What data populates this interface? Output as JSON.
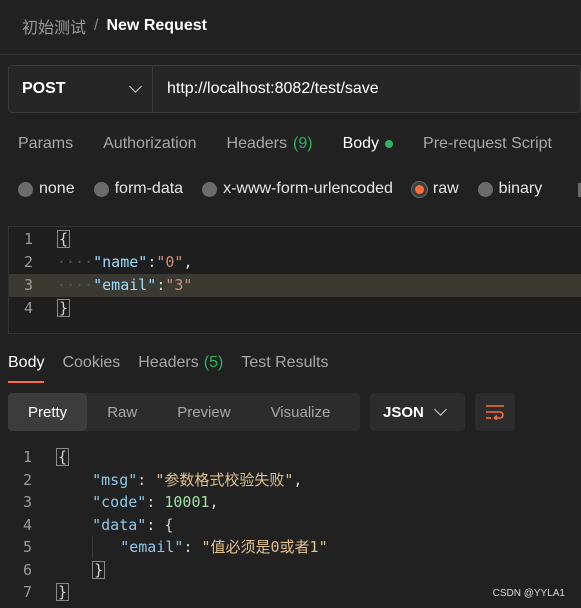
{
  "breadcrumb": {
    "parent": "初始测试",
    "separator": "/",
    "current": "New Request"
  },
  "request": {
    "method": "POST",
    "url": "http://localhost:8082/test/save"
  },
  "tabs": [
    {
      "label": "Params"
    },
    {
      "label": "Authorization"
    },
    {
      "label": "Headers",
      "count": "(9)"
    },
    {
      "label": "Body",
      "active": true
    },
    {
      "label": "Pre-request Script"
    }
  ],
  "body_types": [
    "none",
    "form-data",
    "x-www-form-urlencoded",
    "raw",
    "binary"
  ],
  "body_selected": "raw",
  "request_body": {
    "line_numbers": [
      "1",
      "2",
      "3",
      "4"
    ],
    "open": "{",
    "close": "}",
    "name_key": "\"name\"",
    "name_value": "\"0\"",
    "email_key": "\"email\"",
    "email_value": "\"3\""
  },
  "response_tabs": [
    {
      "label": "Body",
      "active": true
    },
    {
      "label": "Cookies"
    },
    {
      "label": "Headers",
      "count": "(5)"
    },
    {
      "label": "Test Results"
    }
  ],
  "view_modes": [
    "Pretty",
    "Raw",
    "Preview",
    "Visualize"
  ],
  "view_selected": "Pretty",
  "format": "JSON",
  "response_body": {
    "line_numbers": [
      "1",
      "2",
      "3",
      "4",
      "5",
      "6",
      "7"
    ],
    "open": "{",
    "close": "}",
    "msg_key": "\"msg\"",
    "msg_value": "\"参数格式校验失败\"",
    "code_key": "\"code\"",
    "code_value": "10001",
    "data_key": "\"data\"",
    "data_open": "{",
    "email_key": "\"email\"",
    "email_value": "\"值必须是0或者1\"",
    "data_close": "}"
  },
  "watermark": "CSDN @YYLA1",
  "colors": {
    "accent": "#ff6c37",
    "success": "#2fb35a"
  }
}
